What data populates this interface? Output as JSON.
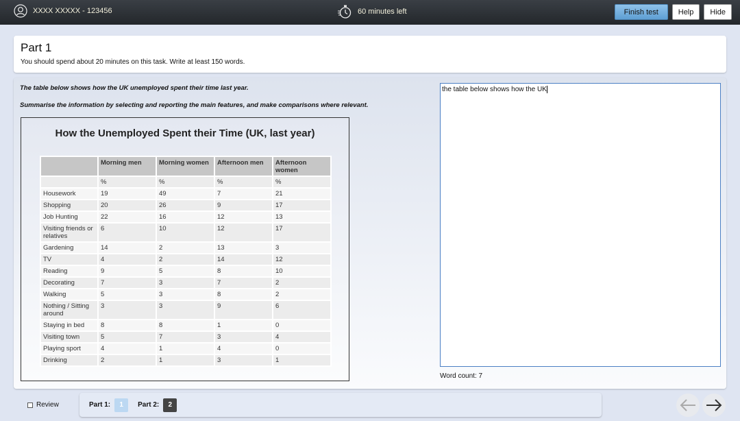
{
  "header": {
    "user": "XXXX XXXXX - 123456",
    "timer": "60 minutes left",
    "finish": "Finish test",
    "help": "Help",
    "hide": "Hide",
    "icons": [
      "user-icon",
      "stopwatch-icon"
    ]
  },
  "part": {
    "title": "Part 1",
    "instructions": "You should spend about 20 minutes on this task. Write at least 150 words."
  },
  "task": {
    "line1": "The table below shows how the UK unemployed spent their time last year.",
    "line2": "Summarise the information by selecting and reporting the main features, and make comparisons where relevant."
  },
  "chart_data": {
    "type": "table",
    "title": "How the Unemployed Spent their Time (UK, last year)",
    "columns": [
      "",
      "Morning men",
      "Morning women",
      "Afternoon men",
      "Afternoon women"
    ],
    "units": [
      "",
      "%",
      "%",
      "%",
      "%"
    ],
    "rows": [
      [
        "Housework",
        19,
        49,
        7,
        21
      ],
      [
        "Shopping",
        20,
        26,
        9,
        17
      ],
      [
        "Job Hunting",
        22,
        16,
        12,
        13
      ],
      [
        "Visiting friends or relatives",
        6,
        10,
        12,
        17
      ],
      [
        "Gardening",
        14,
        2,
        13,
        3
      ],
      [
        "TV",
        4,
        2,
        14,
        12
      ],
      [
        "Reading",
        9,
        5,
        8,
        10
      ],
      [
        "Decorating",
        7,
        3,
        7,
        2
      ],
      [
        "Walking",
        5,
        3,
        8,
        2
      ],
      [
        "Nothing / Sitting around",
        3,
        3,
        9,
        6
      ],
      [
        "Staying in bed",
        8,
        8,
        1,
        0
      ],
      [
        "Visiting town",
        5,
        7,
        3,
        4
      ],
      [
        "Playing sport",
        4,
        1,
        4,
        0
      ],
      [
        "Drinking",
        2,
        1,
        3,
        1
      ]
    ]
  },
  "answer": {
    "text": "the table below shows how the UK",
    "word_count": "Word count: 7"
  },
  "footer": {
    "review": "Review",
    "part1_label": "Part 1:",
    "part1_num": "1",
    "part2_label": "Part 2:",
    "part2_num": "2"
  }
}
